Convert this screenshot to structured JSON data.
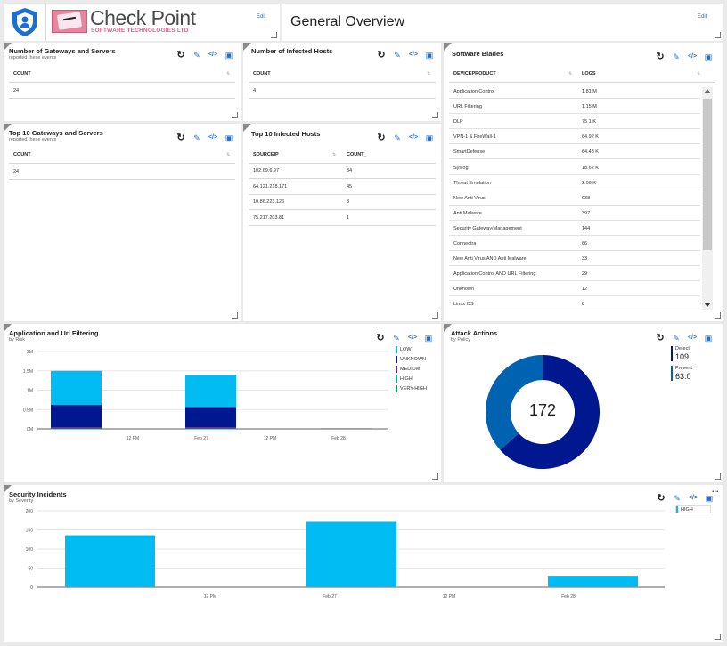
{
  "header": {
    "logo_title": "Check Point",
    "logo_subtitle": "SOFTWARE TECHNOLOGIES LTD",
    "logo_edit": "Edit",
    "page_title": "General Overview",
    "title_edit": "Edit"
  },
  "gateways": {
    "title": "Number of Gateways and Servers",
    "subtitle": "reported these events",
    "column": "COUNT",
    "value": "24"
  },
  "infected_hosts": {
    "title": "Number of Infected Hosts",
    "column": "COUNT",
    "value": "4"
  },
  "top_gateways": {
    "title": "Top 10 Gateways and Servers",
    "subtitle": "reported these events",
    "column": "COUNT",
    "value": "24"
  },
  "top_infected": {
    "title": "Top 10 Infected Hosts",
    "columns": [
      "SOURCEIP",
      "COUNT_"
    ],
    "rows": [
      [
        "102.69.6.97",
        "34"
      ],
      [
        "64.121.218.171",
        "45"
      ],
      [
        "10.86.223.126",
        "8"
      ],
      [
        "75.217.203.81",
        "1"
      ]
    ]
  },
  "software_blades": {
    "title": "Software Blades",
    "columns": [
      "DEVICEPRODUCT",
      "LOGS"
    ],
    "rows": [
      [
        "Application Control",
        "1.81 M"
      ],
      [
        "URL Filtering",
        "1.15 M"
      ],
      [
        "DLP",
        "75.1 K"
      ],
      [
        "VPN-1 & FireWall-1",
        "64.92 K"
      ],
      [
        "SmartDefense",
        "64.43 K"
      ],
      [
        "Syslog",
        "18.62 K"
      ],
      [
        "Threat Emulation",
        "2.06 K"
      ],
      [
        "New Anti Virus",
        "938"
      ],
      [
        "Anti Malware",
        "397"
      ],
      [
        "Security Gateway/Management",
        "144"
      ],
      [
        "Connectra",
        "66"
      ],
      [
        "New Anti Virus AND Anti Malware",
        "33"
      ],
      [
        "Application Control AND URL Filtering",
        "29"
      ],
      [
        "Unknown",
        "12"
      ],
      [
        "Linux OS",
        "8"
      ]
    ]
  },
  "app_url": {
    "title": "Application and Url Filtering",
    "subtitle": "by Risk",
    "legend": [
      {
        "name": "LOW",
        "color": "#00bcf2"
      },
      {
        "name": "UNKNOWN",
        "color": "#00188f"
      },
      {
        "name": "MEDIUM",
        "color": "#68217a"
      },
      {
        "name": "HIGH",
        "color": "#00b294"
      },
      {
        "name": "VERY-HIGH",
        "color": "#009e49"
      }
    ]
  },
  "attack_actions": {
    "title": "Attack Actions",
    "subtitle": "by Policy",
    "total": "172",
    "legend": [
      {
        "name": "Detect",
        "value": "109",
        "color": "#00188f"
      },
      {
        "name": "Prevent",
        "value": "63.0",
        "color": "#0063b1"
      }
    ]
  },
  "security_incidents": {
    "title": "Security Incidents",
    "subtitle": "by Severity",
    "legend": [
      {
        "name": "HIGH",
        "color": "#00bcf2"
      }
    ],
    "more": "..."
  },
  "chart_data": [
    {
      "type": "bar",
      "stacked": true,
      "ylim": [
        0,
        2000000
      ],
      "y_ticks": [
        "2M",
        "1.5M",
        "1M",
        "0.5M",
        "0M"
      ],
      "x_ticks": [
        "12 PM",
        "Feb 27",
        "12 PM",
        "Feb 28"
      ],
      "categories": [
        "Feb 26 12 PM",
        "Feb 27",
        "Feb 28"
      ],
      "series": [
        {
          "name": "VERY-HIGH",
          "color": "#009e49",
          "values": [
            0,
            0,
            0
          ]
        },
        {
          "name": "HIGH",
          "color": "#00b294",
          "values": [
            10000,
            10000,
            0
          ]
        },
        {
          "name": "MEDIUM",
          "color": "#68217a",
          "values": [
            30000,
            30000,
            0
          ]
        },
        {
          "name": "UNKNOWN",
          "color": "#00188f",
          "values": [
            580000,
            530000,
            0
          ]
        },
        {
          "name": "LOW",
          "color": "#00bcf2",
          "values": [
            880000,
            830000,
            20000
          ]
        }
      ]
    },
    {
      "type": "pie",
      "donut": true,
      "labels": [
        "Detect",
        "Prevent"
      ],
      "values": [
        109,
        63
      ],
      "colors": [
        "#00188f",
        "#0063b1"
      ]
    },
    {
      "type": "bar",
      "ylim": [
        0,
        200
      ],
      "y_ticks": [
        "200",
        "150",
        "100",
        "50",
        "0"
      ],
      "x_ticks": [
        "12 PM",
        "Feb 27",
        "12 PM",
        "Feb 28"
      ],
      "categories": [
        "Feb 26 12 PM",
        "Feb 27",
        "Feb 28"
      ],
      "series": [
        {
          "name": "HIGH",
          "color": "#00bcf2",
          "values": [
            136,
            171,
            30
          ]
        }
      ]
    }
  ]
}
